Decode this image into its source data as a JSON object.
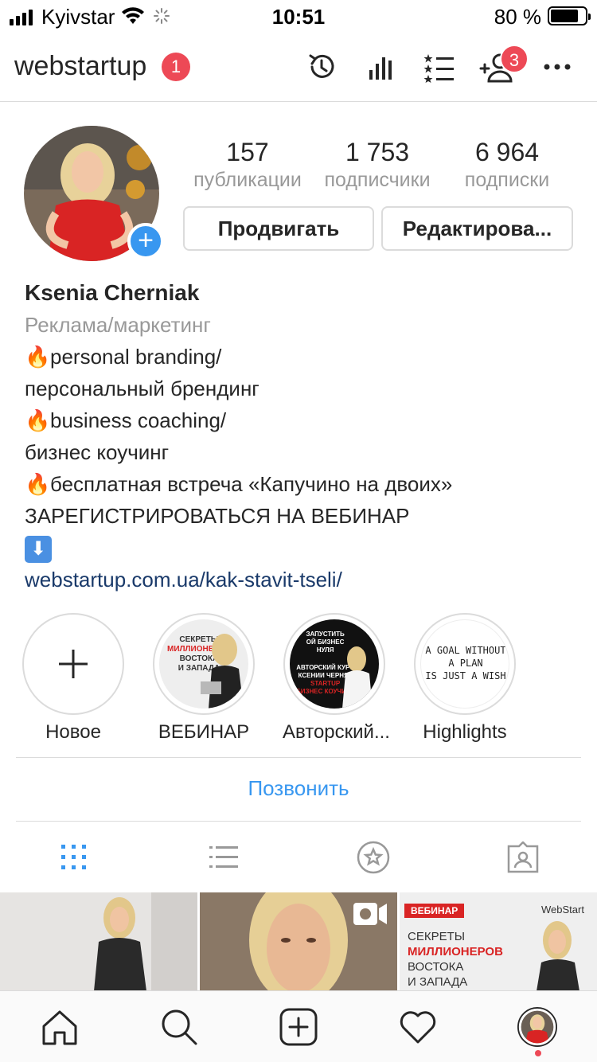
{
  "status_bar": {
    "carrier": "Kyivstar",
    "time": "10:51",
    "battery": "80 %",
    "battery_level": 0.8
  },
  "header": {
    "username": "webstartup",
    "notif_badge": "1",
    "follow_requests_badge": "3",
    "icons": [
      "archive-icon",
      "insights-icon",
      "close-friends-icon",
      "discover-people-icon",
      "more-icon"
    ]
  },
  "profile": {
    "stats": [
      {
        "value": "157",
        "label": "публикации"
      },
      {
        "value": "1 753",
        "label": "подписчики"
      },
      {
        "value": "6 964",
        "label": "подписки"
      }
    ],
    "promote_button": "Продвигать",
    "edit_button": "Редактирова..."
  },
  "bio": {
    "name": "Ksenia Cherniak",
    "category": "Реклама/маркетинг",
    "lines": [
      "personal branding/",
      "персональный брендинг",
      "business coaching/",
      "бизнес коучинг",
      "бесплатная встреча «Капучино на двоих»",
      "ЗАРЕГИСТРИРОВАТЬСЯ НА ВЕБИНАР"
    ],
    "fire_emoji": "🔥",
    "down_emoji": "⬇",
    "link": "webstartup.com.ua/kak-stavit-tseli/"
  },
  "highlights": [
    {
      "label": "Новое"
    },
    {
      "label": "ВЕБИНАР",
      "img_lines": [
        "СЕКРЕТЫ",
        "МИЛЛИОНЕРОВ",
        "ВОСТОКА",
        "И ЗАПАДА"
      ]
    },
    {
      "label": "Авторский...",
      "img_lines": [
        "ЗАПУСТИТЬ",
        "ОЙ БИЗНЕС",
        "НУЛЯ",
        "АВТОРСКИЙ КУРС",
        "КСЕНИИ ЧЕРНЯК",
        "STARTUP",
        "БИЗНЕС КОУЧИНГ"
      ]
    },
    {
      "label": "Highlights",
      "img_lines": [
        "A GOAL WITHOUT",
        "A PLAN",
        "IS JUST A WISH"
      ]
    }
  ],
  "call_button": "Позвонить",
  "grid": {
    "third_tag": "ВЕБИНАР",
    "third_brand": "WebStart",
    "third_lines": [
      "СЕКРЕТЫ",
      "МИЛЛИОНЕРОВ",
      "ВОСТОКА",
      "И ЗАПАДА"
    ]
  },
  "colors": {
    "accent": "#3897f0",
    "badge": "#ed4956",
    "link": "#1a3a6a",
    "muted": "#999999"
  }
}
